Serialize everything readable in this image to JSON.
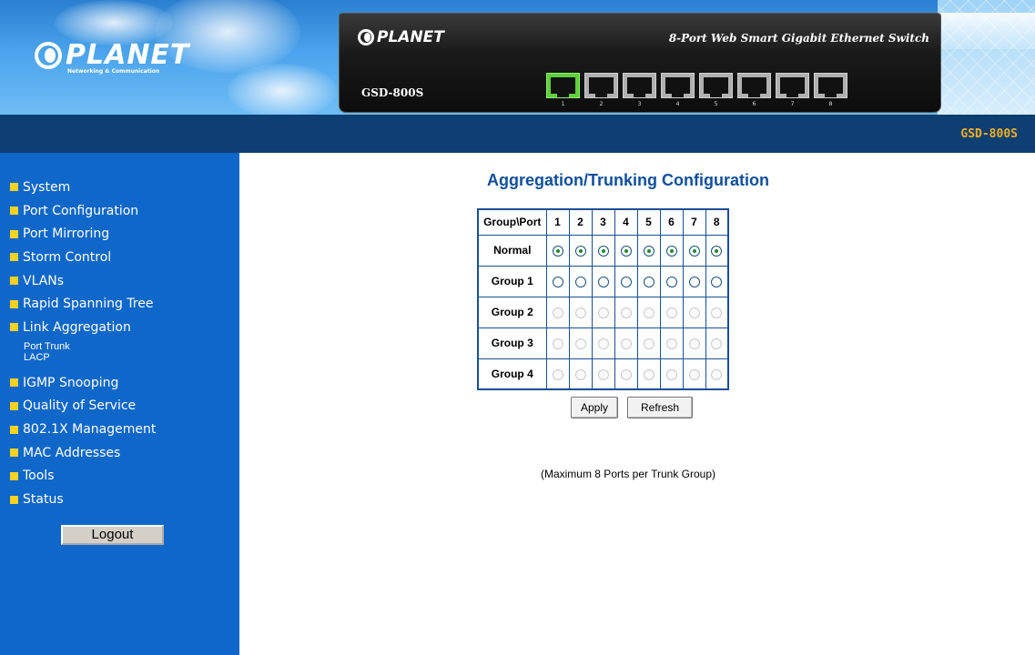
{
  "header": {
    "brand": "PLANET",
    "brand_tagline": "Networking & Communication",
    "device_brand": "PLANET",
    "device_model": "GSD-800S",
    "device_title": "8-Port Web Smart Gigabit Ethernet Switch",
    "ports": [
      {
        "num": "1",
        "active": true
      },
      {
        "num": "2",
        "active": false
      },
      {
        "num": "3",
        "active": false
      },
      {
        "num": "4",
        "active": false
      },
      {
        "num": "5",
        "active": false
      },
      {
        "num": "6",
        "active": false
      },
      {
        "num": "7",
        "active": false
      },
      {
        "num": "8",
        "active": false
      }
    ]
  },
  "topbar": {
    "model": "GSD-800S"
  },
  "sidebar": {
    "items": [
      {
        "label": "System"
      },
      {
        "label": "Port Configuration"
      },
      {
        "label": "Port Mirroring"
      },
      {
        "label": "Storm Control"
      },
      {
        "label": "VLANs"
      },
      {
        "label": "Rapid Spanning Tree"
      },
      {
        "label": "Link Aggregation",
        "sub": [
          "Port Trunk",
          "LACP"
        ]
      },
      {
        "label": "IGMP Snooping"
      },
      {
        "label": "Quality of Service"
      },
      {
        "label": "802.1X Management"
      },
      {
        "label": "MAC Addresses"
      },
      {
        "label": "Tools"
      },
      {
        "label": "Status"
      }
    ],
    "logout_label": "Logout"
  },
  "main": {
    "title": "Aggregation/Trunking Configuration",
    "table": {
      "corner_header": "Group\\Port",
      "ports": [
        "1",
        "2",
        "3",
        "4",
        "5",
        "6",
        "7",
        "8"
      ],
      "rows": [
        {
          "label": "Normal",
          "state": "checked"
        },
        {
          "label": "Group 1",
          "state": "enabled"
        },
        {
          "label": "Group 2",
          "state": "disabled"
        },
        {
          "label": "Group 3",
          "state": "disabled"
        },
        {
          "label": "Group 4",
          "state": "disabled"
        }
      ]
    },
    "apply_label": "Apply",
    "refresh_label": "Refresh",
    "note": "(Maximum 8 Ports per Trunk Group)"
  },
  "colors": {
    "sidebar_bg": "#0e67c9",
    "topbar_bg": "#0d3f73",
    "bullet": "#f7d220",
    "title": "#0f4f9b",
    "model_text": "#f0b020",
    "active_port": "#5fcf3a"
  }
}
